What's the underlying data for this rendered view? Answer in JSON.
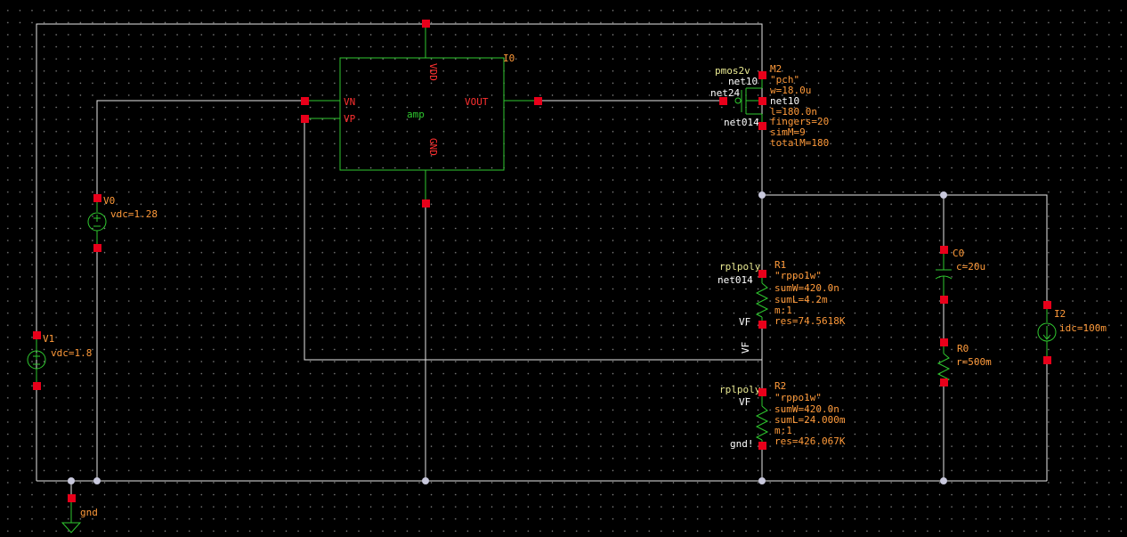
{
  "schematic": {
    "amp": {
      "instance": "I0",
      "cell": "amp",
      "pins": {
        "vdd": "VDD",
        "gnd": "GND",
        "vn": "VN",
        "vp": "VP",
        "vout": "VOUT"
      }
    },
    "m2": {
      "instance": "M2",
      "cell": "pmos2v",
      "model": "\"pch\"",
      "w": "w=18.0u",
      "l": "l=180.0n",
      "fingers": "fingers=20",
      "simm": "simM=9",
      "totalm": "totalM=180",
      "pin_s": "net10",
      "pin_g": "net24",
      "pin_b": "net10",
      "pin_d": "net014"
    },
    "r1": {
      "instance": "R1",
      "cell": "rplpoly",
      "model": "\"rppo1w\"",
      "sumw": "sumW=420.0n",
      "suml": "sumL=4.2m",
      "m": "m:1",
      "res": "res=74.5618K",
      "pin_top": "net014",
      "pin_bot": "VF"
    },
    "r2": {
      "instance": "R2",
      "cell": "rplpoly",
      "model": "\"rppo1w\"",
      "sumw": "sumW=420.0n",
      "suml": "sumL=24.000m",
      "m": "m:1",
      "res": "res=426.067K",
      "pin_top": "VF",
      "pin_bot": "gnd!"
    },
    "v0": {
      "instance": "V0",
      "value": "vdc=1.28"
    },
    "v1": {
      "instance": "V1",
      "value": "vdc=1.8"
    },
    "c0": {
      "instance": "C0",
      "value": "c=20u"
    },
    "rb0": {
      "instance": "R0",
      "value": "r=500m"
    },
    "i2": {
      "instance": "I2",
      "value": "idc=100m"
    },
    "net_vf": "VF",
    "gnd": "gnd"
  }
}
